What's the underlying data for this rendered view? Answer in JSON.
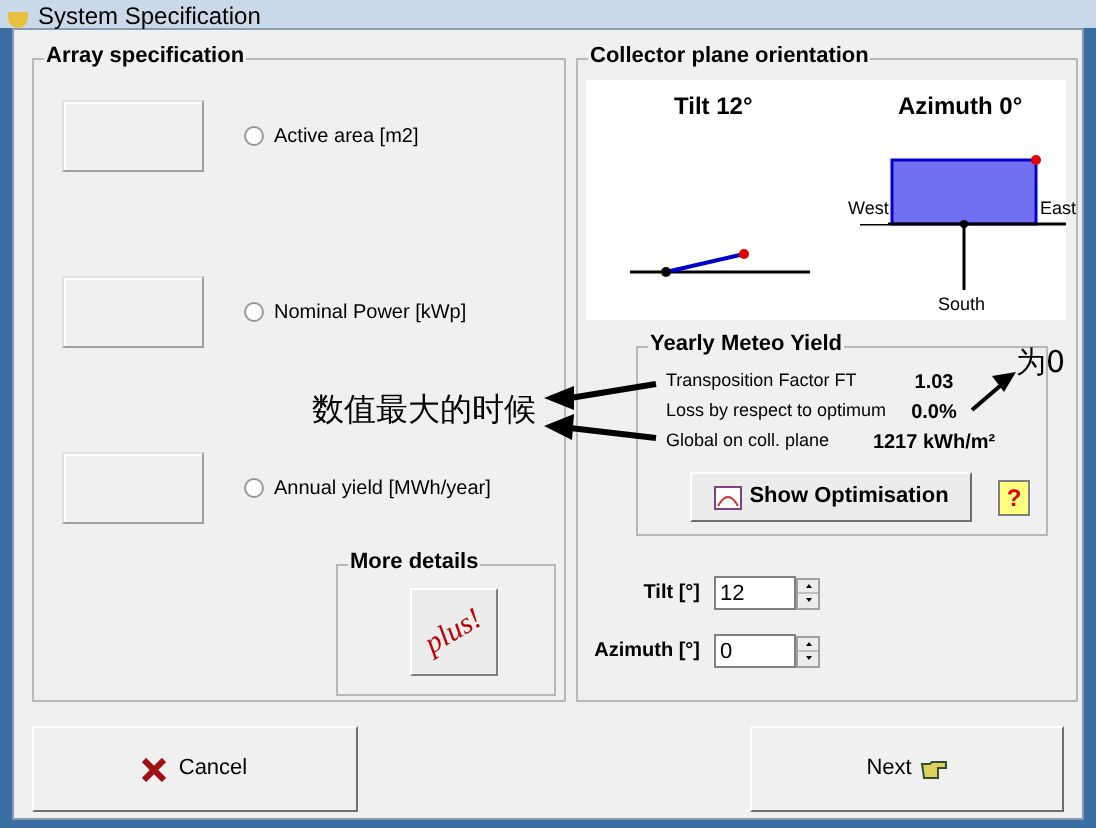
{
  "window": {
    "title": "System Specification"
  },
  "array_specification": {
    "title": "Array specification",
    "options": [
      {
        "label": "Active area [m2]",
        "selected": false
      },
      {
        "label": "Nominal Power [kWp]",
        "selected": false
      },
      {
        "label": "Annual yield [MWh/year]",
        "selected": false
      }
    ],
    "more_details": {
      "title": "More details",
      "button_label": "plus!"
    }
  },
  "collector_plane": {
    "title": "Collector plane orientation",
    "tilt_title": "Tilt 12°",
    "azimuth_title": "Azimuth 0°",
    "west": "West",
    "east": "East",
    "south": "South"
  },
  "yearly_meteo_yield": {
    "title": "Yearly Meteo Yield",
    "rows": [
      {
        "label": "Transposition Factor FT",
        "value": "1.03"
      },
      {
        "label": "Loss by respect to optimum",
        "value": "0.0%"
      },
      {
        "label": "Global on coll. plane",
        "value": "1217 kWh/m²"
      }
    ],
    "show_button": "Show Optimisation",
    "help_button": "?"
  },
  "inputs": [
    {
      "label": "Tilt [°]",
      "value": "12"
    },
    {
      "label": "Azimuth [°]",
      "value": "0"
    }
  ],
  "annotations": [
    {
      "text": "数值最大的时候"
    },
    {
      "text": "为0"
    }
  ],
  "buttons": {
    "cancel": "Cancel",
    "next": "Next"
  }
}
